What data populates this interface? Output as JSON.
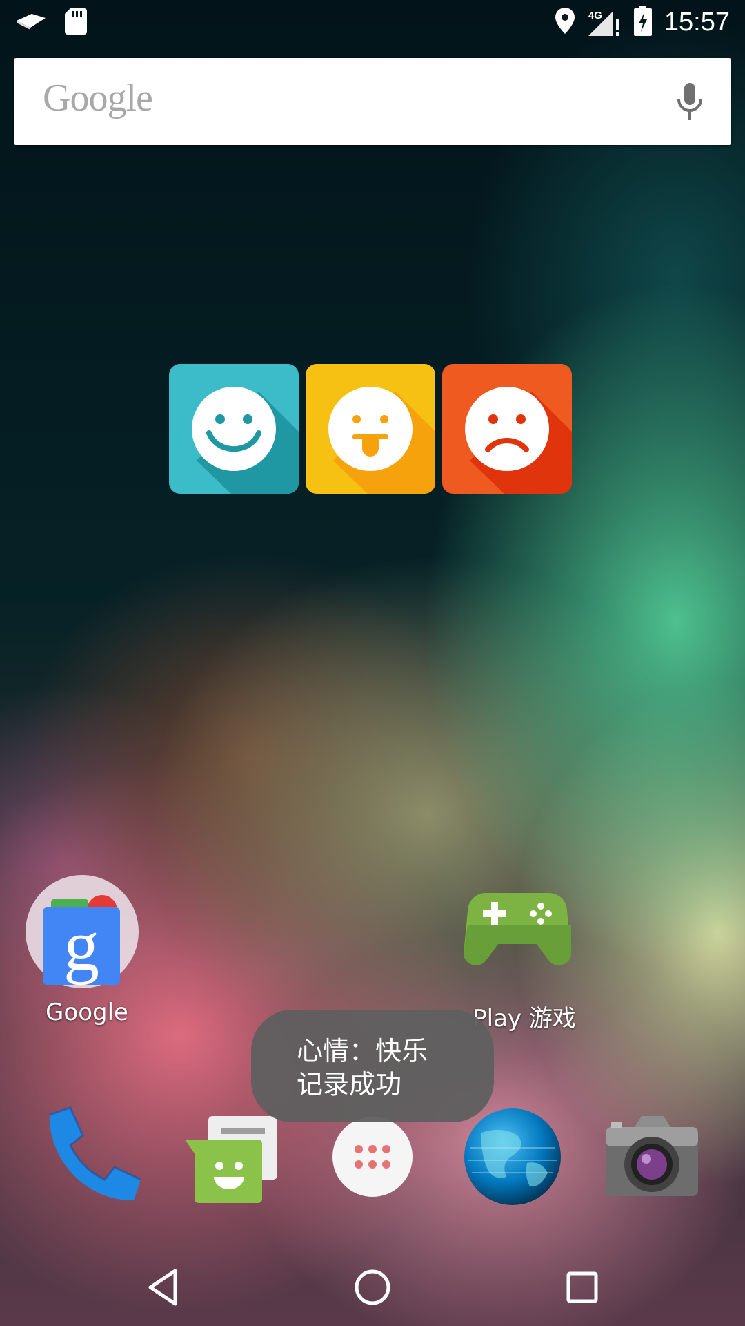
{
  "status_bar": {
    "left_icons": [
      "kindle-icon",
      "sd-card-icon"
    ],
    "right_icons": [
      "location-icon",
      "signal-icon",
      "battery-icon"
    ],
    "network_label": "4G",
    "time": "15:57"
  },
  "search": {
    "logo_text": "Google",
    "icon": "mic-icon"
  },
  "mood_widget": {
    "buttons": [
      {
        "mood": "happy",
        "color": "#3bbcc8",
        "icon": "smile-face-icon"
      },
      {
        "mood": "playful",
        "color": "#f7c113",
        "icon": "tongue-face-icon"
      },
      {
        "mood": "sad",
        "color": "#ee5a20",
        "icon": "sad-face-icon"
      }
    ]
  },
  "apps": {
    "google": {
      "label": "Google",
      "icon": "google-folder-icon"
    },
    "play_games": {
      "label": "Play 游戏",
      "icon": "gamepad-icon"
    }
  },
  "toast": {
    "message": "心情：快乐\n记录成功"
  },
  "dock": {
    "items": [
      {
        "name": "phone",
        "icon": "phone-icon"
      },
      {
        "name": "messaging",
        "icon": "messaging-icon"
      },
      {
        "name": "all-apps",
        "icon": "app-drawer-icon"
      },
      {
        "name": "browser",
        "icon": "globe-icon"
      },
      {
        "name": "camera",
        "icon": "camera-icon"
      }
    ]
  },
  "nav_bar": {
    "buttons": [
      "back",
      "home",
      "recents"
    ]
  }
}
